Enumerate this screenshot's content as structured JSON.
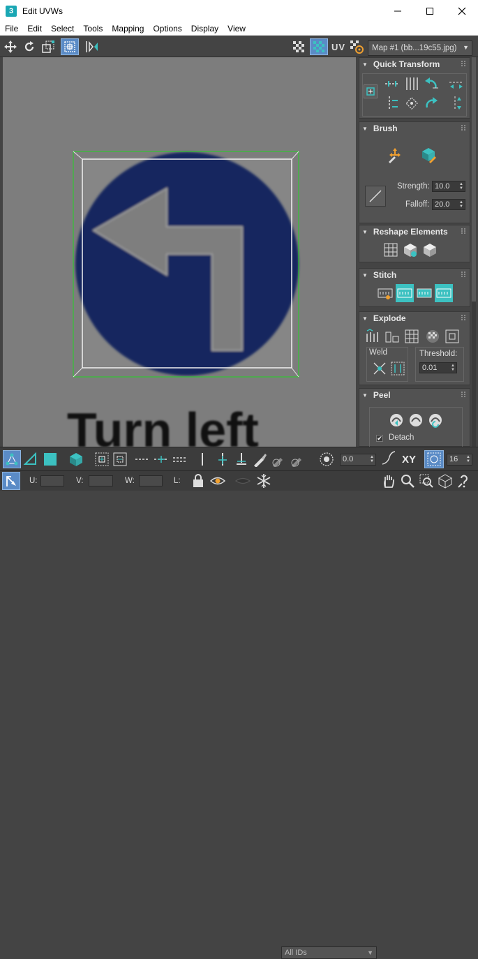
{
  "window": {
    "app_icon": "3",
    "title": "Edit UVWs",
    "minimize_icon": "minimize-icon",
    "maximize_icon": "maximize-icon",
    "close_icon": "close-icon"
  },
  "menu": [
    "File",
    "Edit",
    "Select",
    "Tools",
    "Mapping",
    "Options",
    "Display",
    "View"
  ],
  "top_toolbar": {
    "uv_label": "UV",
    "map_select": "Map #1 (bb...19c55.jpg)"
  },
  "viewport": {
    "sign_text": "Turn left",
    "colors": {
      "background": "#7d7d7d",
      "sign_blue": "#16285e",
      "gizmo_green": "#22d322"
    }
  },
  "panel": {
    "quick_transform": {
      "title": "Quick Transform"
    },
    "brush": {
      "title": "Brush",
      "strength_label": "Strength:",
      "strength_value": "10.0",
      "falloff_label": "Falloff:",
      "falloff_value": "20.0"
    },
    "reshape": {
      "title": "Reshape Elements"
    },
    "stitch": {
      "title": "Stitch"
    },
    "explode": {
      "title": "Explode",
      "weld_label": "Weld",
      "threshold_label": "Threshold:",
      "threshold_value": "0.01"
    },
    "peel": {
      "title": "Peel",
      "detach_label": "Detach",
      "detach_checked": true
    }
  },
  "bottom_toolbar": {
    "angle_value": "0.0",
    "xy_label": "XY",
    "grid_value": "16",
    "u_label": "U:",
    "v_label": "V:",
    "w_label": "W:",
    "l_label": "L:",
    "ids_select": "All IDs"
  },
  "colors": {
    "accent_teal": "#3cc1c1",
    "selected_blue": "#5a8bc6"
  }
}
